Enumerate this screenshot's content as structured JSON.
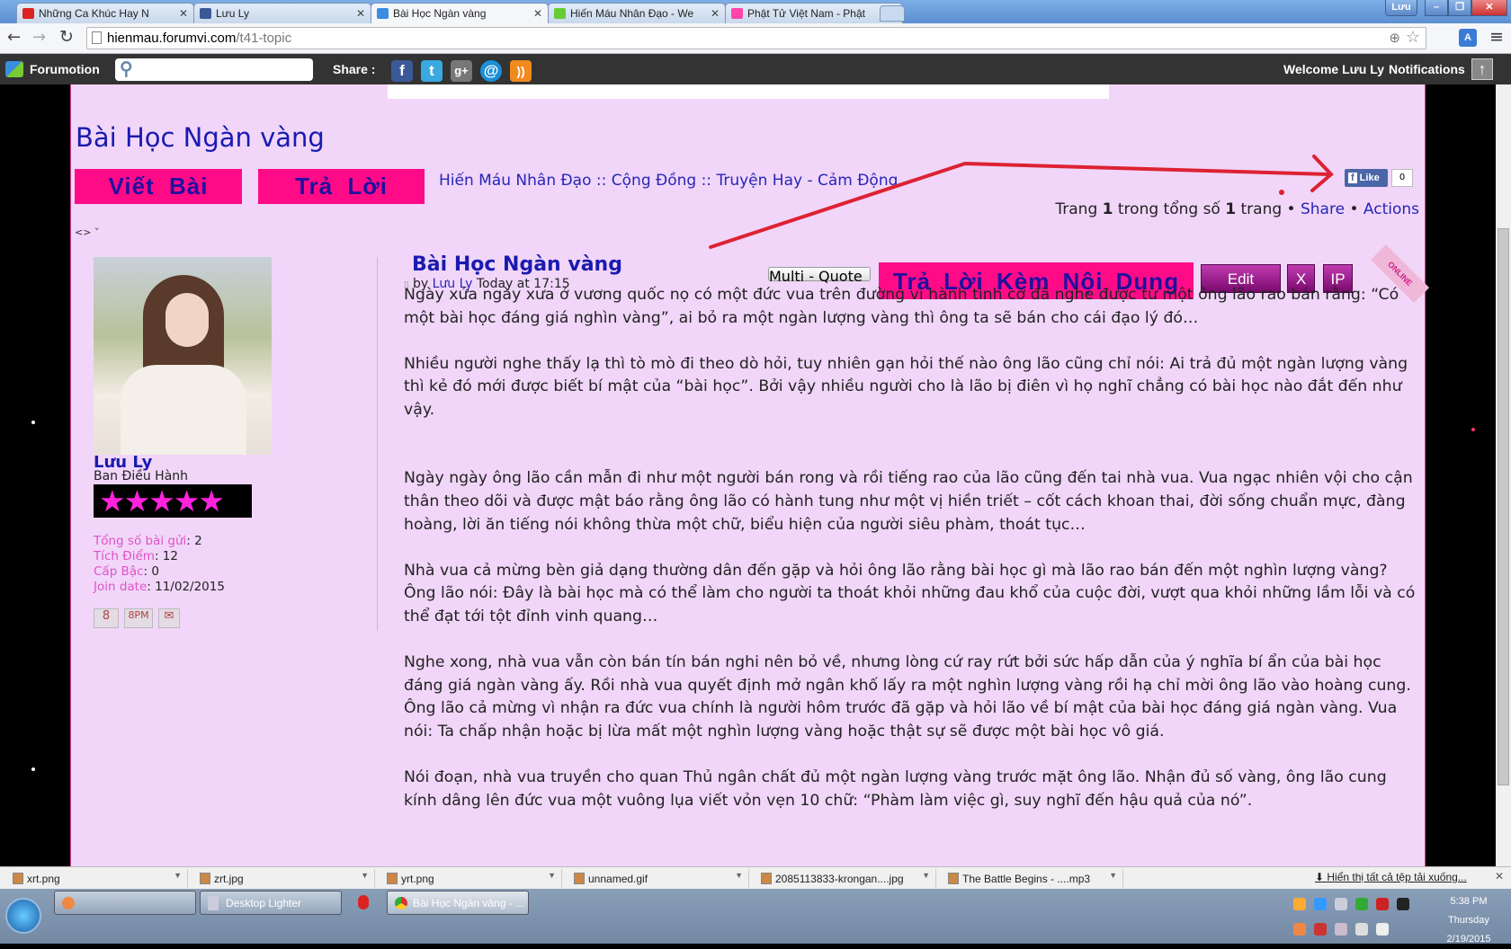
{
  "browser": {
    "tabs": [
      {
        "label": "Những Ca Khúc Hay N",
        "icon": "youtube-icon",
        "color": "#d22"
      },
      {
        "label": "Lưu Ly",
        "icon": "facebook-icon",
        "color": "#3b5998"
      },
      {
        "label": "Bài Học Ngàn vàng",
        "icon": "forum-chat-icon",
        "color": "#3a8de0",
        "active": true
      },
      {
        "label": "Hiến Máu Nhân Đạo - We",
        "icon": "chat-bubble-icon",
        "color": "#6c3"
      },
      {
        "label": "Phật Tử Việt Nam - Phật",
        "icon": "flag-icon",
        "color": "#f4a"
      }
    ],
    "user_label": "Lưu",
    "url_host": "hienmau.forumvi.com",
    "url_path": "/t41-topic"
  },
  "forumotion_bar": {
    "logo": "Forumotion",
    "search_placeholder": "",
    "share_label": "Share :",
    "share_icons": [
      "facebook-icon",
      "twitter-icon",
      "google-plus-icon",
      "email-icon",
      "rss-icon"
    ],
    "welcome": "Welcome Lưu Ly",
    "notifications": "Notifications"
  },
  "topic": {
    "title": "Bài Học Ngàn vàng",
    "new_topic_btn": "Viết Bài",
    "reply_btn": "Trả Lời",
    "breadcrumb": [
      "Hiến Máu Nhân Đạo",
      "Cộng Đồng",
      "Truyện Hay - Cảm Động"
    ],
    "breadcrumb_sep": "::",
    "like_label": "Like",
    "like_count": "0",
    "pagination": {
      "prefix": "Trang",
      "current": "1",
      "middle": "trong tổng số",
      "total": "1",
      "suffix": "trang"
    },
    "share": "Share",
    "actions": "Actions",
    "toggle": "<> ˅"
  },
  "author": {
    "name": "Lưu Ly",
    "rank": "Ban Điều Hành",
    "stars": 5,
    "stats": [
      {
        "k": "Tổng số bài gửi",
        "v": "2"
      },
      {
        "k": "Tích Điểm",
        "v": "12"
      },
      {
        "k": "Cấp Bậc",
        "v": "0"
      },
      {
        "k": "Join date",
        "v": "11/02/2015"
      }
    ],
    "status": "ONLINE"
  },
  "post": {
    "title": "Bài Học Ngàn vàng",
    "by": "by",
    "author": "Lưu Ly",
    "time": "Today at 17:15",
    "multi_quote": "Multi - Quote",
    "quote_reply": "Trả Lời Kèm Nội Dung",
    "edit": "Edit",
    "delete": "X",
    "ip": "IP",
    "paragraphs": [
      "Ngày xửa ngày xưa ở vương quốc nọ có một đức vua trên đường vi hành tình cờ đã nghe được từ một ông lão rao bán rằng: “Có một bài học đáng giá nghìn vàng”, ai bỏ ra một ngàn lượng vàng thì ông ta sẽ bán cho cái đạo lý đó…",
      "Nhiều người nghe thấy lạ thì tò mò đi theo dò hỏi, tuy nhiên gạn hỏi thế nào ông lão cũng chỉ nói: Ai trả đủ một ngàn lượng vàng thì kẻ đó mới được biết bí mật của “bài học”. Bởi vậy nhiều người cho là lão bị điên vì họ nghĩ chẳng có bài học nào đắt đến như vậy.",
      "Ngày ngày ông lão cần mẫn đi như một người bán rong và rồi tiếng rao của lão cũng đến tai nhà vua. Vua ngạc nhiên vội cho cận thân theo dõi và được mật báo rằng ông lão có hành tung như một vị hiền triết – cốt cách khoan thai, đời sống chuẩn mực, đàng hoàng, lời ăn tiếng nói không thừa một chữ, biểu hiện của người siêu phàm, thoát tục…",
      "Nhà vua cả mừng bèn giả dạng thường dân đến gặp và hỏi ông lão rằng bài học gì mà lão rao bán đến một nghìn lượng vàng? Ông lão nói: Đây là bài học mà có thể làm cho người ta thoát khỏi những đau khổ của cuộc đời, vượt qua khỏi những lầm lỗi và có thể đạt tới tột đỉnh vinh quang…",
      "Nghe xong, nhà vua vẫn còn bán tín bán nghi nên bỏ về, nhưng lòng cứ ray rứt bởi sức hấp dẫn của ý nghĩa bí ẩn của bài học đáng giá ngàn vàng ấy. Rồi nhà vua quyết định mở ngân khố lấy ra một nghìn lượng vàng rồi hạ chỉ mời ông lão vào hoàng cung. Ông lão cả mừng vì nhận ra đức vua chính là người hôm trước đã gặp và hỏi lão về bí mật của bài học đáng giá ngàn vàng. Vua nói: Ta chấp nhận hoặc bị lừa mất một nghìn lượng vàng hoặc thật sự sẽ được một bài học vô giá.",
      "Nói đoạn, nhà vua truyền cho quan Thủ ngân chất đủ một ngàn lượng vàng trước mặt ông lão. Nhận đủ số vàng, ông lão cung kính dâng lên đức vua một vuông lụa viết vỏn vẹn 10 chữ: “Phàm làm việc gì, suy nghĩ đến hậu quả của nó”."
    ]
  },
  "downloads": {
    "items": [
      "xrt.png",
      "zrt.jpg",
      "yrt.png",
      "unnamed.gif",
      "2085113833-krongan....jpg",
      "The Battle Begins - ....mp3"
    ],
    "show_all": "Hiển thị tất cả tệp tải xuống..."
  },
  "taskbar": {
    "items": [
      "",
      "Desktop Lighter",
      "Bài Học Ngàn vàng - ..."
    ],
    "time": "5:38 PM",
    "day": "Thursday",
    "date": "2/19/2015"
  },
  "colors": {
    "page_bg": "#f1d6f9",
    "accent_pink": "#ff0b88",
    "link": "#2626b8",
    "annotation_arrow": "#dd2233"
  }
}
